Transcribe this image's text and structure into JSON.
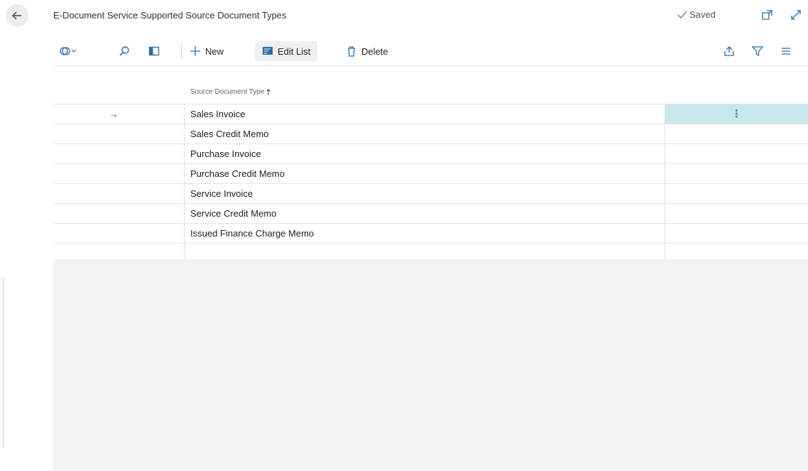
{
  "header": {
    "title": "E-Document Service Supported Source Document Types",
    "status": "Saved"
  },
  "toolbar": {
    "new_label": "New",
    "edit_list_label": "Edit List",
    "delete_label": "Delete"
  },
  "grid": {
    "column_header": "Source Document Type",
    "rows": [
      "Sales Invoice",
      "Sales Credit Memo",
      "Purchase Invoice",
      "Purchase Credit Memo",
      "Service Invoice",
      "Service Credit Memo",
      "Issued Finance Charge Memo",
      ""
    ],
    "selected_row_index": 0
  },
  "colors": {
    "selection": "#c8e8ee",
    "toolbar_button_bg": "#eef0f2",
    "list_background": "#f3f3f3",
    "accent": "#2b6ea8"
  },
  "icons": {
    "back": "arrow-left-icon",
    "saved": "check-icon",
    "open_new_window": "open-new-window-icon",
    "expand": "expand-icon",
    "views": "views-icon",
    "search": "search-icon",
    "filter_pane": "filter-pane-icon",
    "new": "plus-icon",
    "edit_list": "edit-list-icon",
    "delete": "trash-icon",
    "share": "share-icon",
    "filter": "filter-icon",
    "list": "list-icon",
    "row_arrow": "arrow-right-icon",
    "row_menu": "more-vertical-icon",
    "sort": "sort-ascending-icon"
  }
}
